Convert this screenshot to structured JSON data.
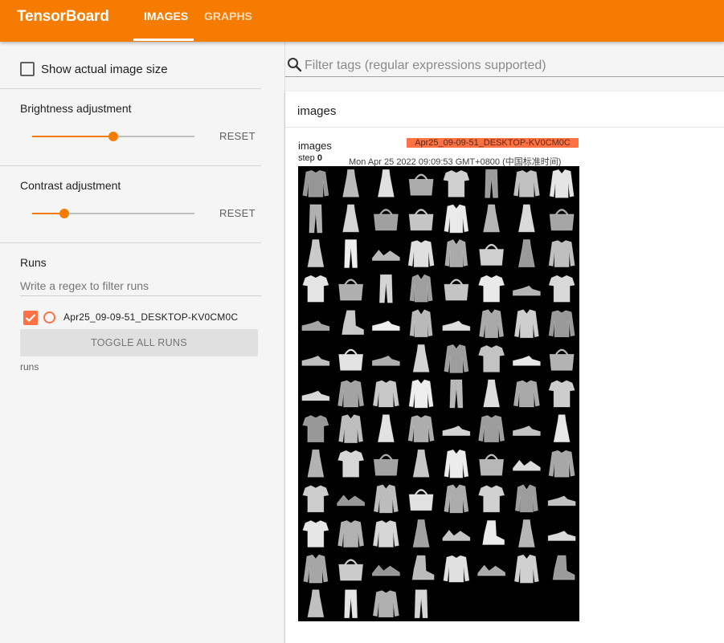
{
  "app": {
    "title": "TensorBoard"
  },
  "tabs": [
    {
      "label": "IMAGES",
      "active": true
    },
    {
      "label": "GRAPHS",
      "active": false
    }
  ],
  "colors": {
    "accent": "#f57c00",
    "run_color": "#ff7043"
  },
  "sidebar": {
    "show_actual_size_label": "Show actual image size",
    "show_actual_size_checked": false,
    "brightness": {
      "label": "Brightness adjustment",
      "value_fraction": 0.5,
      "reset_label": "RESET"
    },
    "contrast": {
      "label": "Contrast adjustment",
      "value_fraction": 0.2,
      "reset_label": "RESET"
    },
    "runs": {
      "title": "Runs",
      "filter_placeholder": "Write a regex to filter runs",
      "items": [
        {
          "name": "Apr25_09-09-51_DESKTOP-KV0CM0C",
          "checked": true
        }
      ],
      "toggle_label": "TOGGLE ALL RUNS",
      "caption": "runs"
    }
  },
  "main": {
    "filter_placeholder": "Filter tags (regular expressions supported)",
    "card": {
      "title": "images",
      "image": {
        "tag": "images",
        "step_label": "step",
        "step_value": "0",
        "run_badge": "Apr25_09-09-51_DESKTOP-KV0CM0C",
        "timestamp": "Mon Apr 25 2022 09:09:53 GMT+0800 (中国标准时间)",
        "grid": {
          "description_items": [
            "tshirt",
            "trouser",
            "pullover",
            "dress",
            "coat",
            "sandal",
            "shirt",
            "sneaker",
            "bag",
            "boot"
          ],
          "cells": [
            "pullover",
            "dress",
            "dress",
            "bag",
            "tshirt",
            "trouser",
            "pullover",
            "coat",
            "trouser",
            "dress",
            "bag",
            "bag",
            "coat",
            "dress",
            "dress",
            "bag",
            "dress",
            "trouser",
            "sandal",
            "pullover",
            "shirt",
            "bag",
            "dress",
            "pullover",
            "tshirt",
            "bag",
            "trouser",
            "shirt",
            "bag",
            "tshirt",
            "sneaker",
            "tshirt",
            "sneaker",
            "boot",
            "sneaker",
            "shirt",
            "sneaker",
            "coat",
            "coat",
            "pullover",
            "sneaker",
            "bag",
            "sneaker",
            "dress",
            "coat",
            "tshirt",
            "sneaker",
            "bag",
            "sneaker",
            "pullover",
            "pullover",
            "coat",
            "trouser",
            "dress",
            "pullover",
            "tshirt",
            "tshirt",
            "coat",
            "dress",
            "pullover",
            "sneaker",
            "pullover",
            "sneaker",
            "dress",
            "dress",
            "tshirt",
            "bag",
            "dress",
            "coat",
            "bag",
            "sandal",
            "pullover",
            "tshirt",
            "sandal",
            "coat",
            "bag",
            "coat",
            "tshirt",
            "shirt",
            "sneaker",
            "tshirt",
            "pullover",
            "pullover",
            "dress",
            "sandal",
            "boot",
            "dress",
            "sneaker",
            "coat",
            "bag",
            "sandal",
            "boot",
            "pullover",
            "sandal",
            "coat",
            "boot",
            "dress",
            "trouser",
            "pullover",
            "trouser"
          ]
        }
      }
    }
  }
}
